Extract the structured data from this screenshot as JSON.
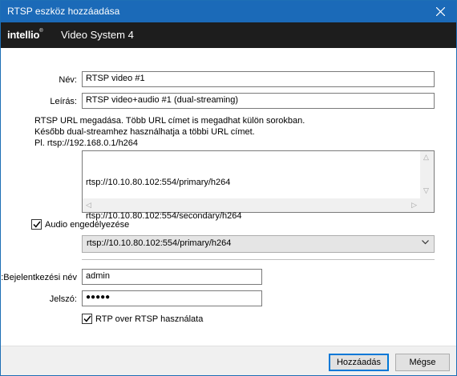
{
  "window": {
    "title": "RTSP eszköz hozzáadása"
  },
  "brand": {
    "logo": "intellio",
    "trademark": "®",
    "product": "Video System 4"
  },
  "form": {
    "name_label": "Név:",
    "name_value": "RTSP video #1",
    "desc_label": "Leírás:",
    "desc_value": "RTSP video+audio #1 (dual-streaming)",
    "hint_lines": [
      "RTSP URL megadása. Több URL címet is megadhat külön sorokban.",
      "Később dual-streamhez használhatja a többi URL címet.",
      "Pl. rtsp://192.168.0.1/h264"
    ],
    "urls": [
      "rtsp://10.10.80.102:554/primary/h264",
      "rtsp://10.10.80.102:554/secondary/h264"
    ],
    "audio_label": "Audio engedélyezése",
    "audio_checked": true,
    "audio_select_value": "rtsp://10.10.80.102:554/primary/h264",
    "login_label": "Bejelentkezési név:",
    "login_value": "admin",
    "password_label": "Jelszó:",
    "password_value": "●●●●●",
    "rtp_label": "RTP over RTSP használata",
    "rtp_checked": true
  },
  "footer": {
    "add_label": "Hozzáadás",
    "cancel_label": "Mégse"
  }
}
